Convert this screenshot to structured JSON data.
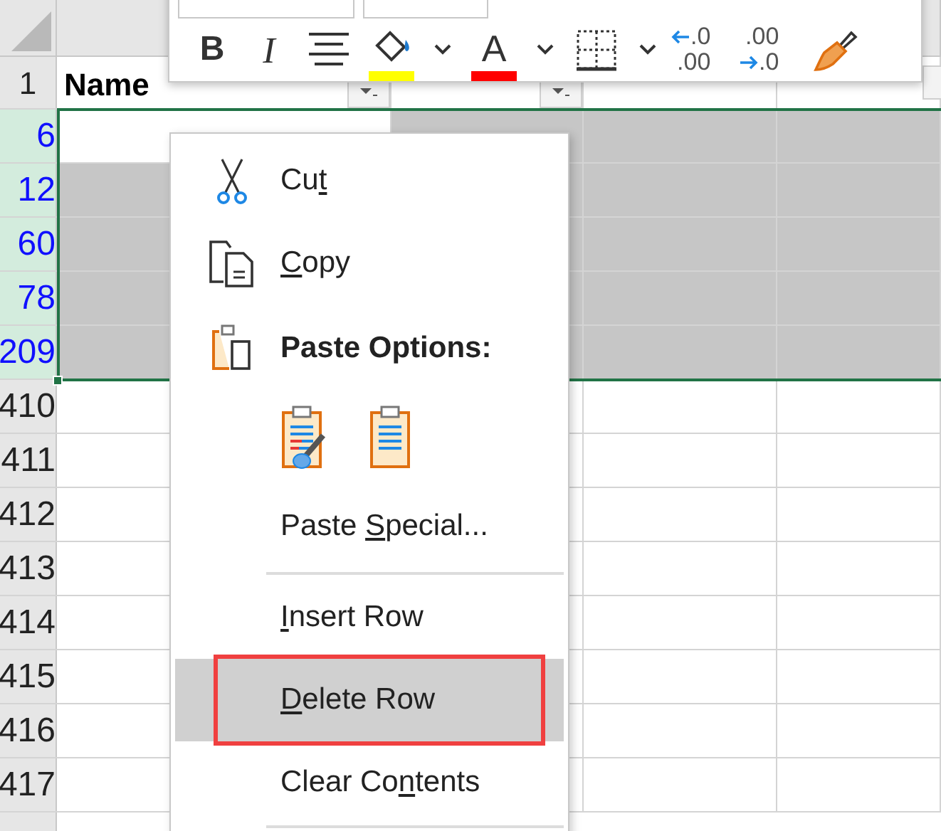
{
  "toolbar": {
    "buttons": [
      {
        "kind": "bold",
        "text": "B"
      },
      {
        "kind": "italic",
        "text": "I"
      },
      {
        "kind": "align"
      },
      {
        "kind": "fill-color",
        "color": "#ffff00"
      },
      {
        "kind": "chevron"
      },
      {
        "kind": "font-color",
        "text": "A",
        "color": "#ff0000"
      },
      {
        "kind": "chevron"
      },
      {
        "kind": "borders"
      },
      {
        "kind": "chevron"
      },
      {
        "kind": "decimal-less",
        "digits": [
          ".0",
          ".00"
        ]
      },
      {
        "kind": "decimal-more",
        "digits": [
          ".00",
          ".0"
        ]
      },
      {
        "kind": "format-painter"
      }
    ]
  },
  "sheet": {
    "header_row": {
      "number": "1",
      "cells": [
        {
          "text": "Name",
          "filter": true
        },
        {
          "filter": true
        },
        {
          "filter": false
        },
        {
          "filter": false
        }
      ]
    },
    "rows": [
      {
        "number": "6",
        "selected": true,
        "active": true
      },
      {
        "number": "12",
        "selected": true
      },
      {
        "number": "60",
        "selected": true
      },
      {
        "number": "78",
        "selected": true
      },
      {
        "number": "209",
        "selected": true
      },
      {
        "number": "410",
        "selected": false
      },
      {
        "number": "411",
        "selected": false
      },
      {
        "number": "412",
        "selected": false
      },
      {
        "number": "413",
        "selected": false
      },
      {
        "number": "414",
        "selected": false
      },
      {
        "number": "415",
        "selected": false
      },
      {
        "number": "416",
        "selected": false
      },
      {
        "number": "417",
        "selected": false
      }
    ]
  },
  "context_menu": {
    "items": [
      {
        "kind": "cut",
        "label": {
          "before": "Cu",
          "key": "t"
        },
        "selected": false
      },
      {
        "kind": "copy",
        "label": {
          "key": "C",
          "after": "opy"
        },
        "selected": false
      },
      {
        "kind": "paste-header",
        "label": "Paste Options:"
      },
      {
        "kind": "paste-options"
      },
      {
        "kind": "command",
        "label": {
          "before": "Paste ",
          "key": "S",
          "after": "pecial..."
        },
        "selected": false
      },
      {
        "kind": "separator"
      },
      {
        "kind": "command",
        "label": {
          "key": "I",
          "after": "nsert Row"
        },
        "selected": false
      },
      {
        "kind": "command",
        "label": {
          "key": "D",
          "after": "elete Row"
        },
        "selected": true,
        "outlined": true
      },
      {
        "kind": "command",
        "label": {
          "before": "Clear Co",
          "key": "n",
          "after": "tents"
        },
        "selected": false
      },
      {
        "kind": "separator"
      }
    ]
  }
}
